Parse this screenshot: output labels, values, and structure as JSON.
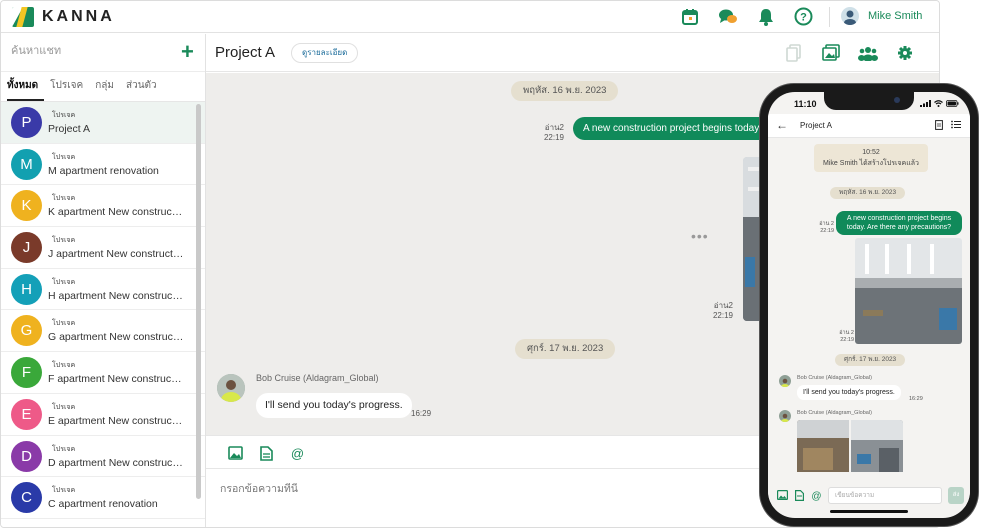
{
  "app": {
    "name": "KANNA",
    "user_name": "Mike Smith"
  },
  "colors": {
    "accent": "#108a5a",
    "date_pill": "#e5dfcf",
    "chat_bg": "#eeedeb"
  },
  "top_icons": [
    "calendar-icon",
    "chat-icon",
    "bell-icon",
    "help-icon"
  ],
  "sidebar": {
    "search_placeholder": "ค้นหาแชท",
    "add_label": "+",
    "tabs": [
      {
        "label": "ทั้งหมด",
        "active": true
      },
      {
        "label": "โปรเจค",
        "active": false
      },
      {
        "label": "กลุ่ม",
        "active": false
      },
      {
        "label": "ส่วนตัว",
        "active": false
      }
    ],
    "chats": [
      {
        "initial": "P",
        "type": "โปรเจค",
        "name": "Project A",
        "color": "#3a3aa8",
        "selected": true
      },
      {
        "initial": "M",
        "type": "โปรเจค",
        "name": "M apartment renovation",
        "color": "#12a0b0",
        "selected": false
      },
      {
        "initial": "K",
        "type": "โปรเจค",
        "name": "K apartment New construction",
        "color": "#efb21f",
        "selected": false
      },
      {
        "initial": "J",
        "type": "โปรเจค",
        "name": "J apartment New construction",
        "color": "#7a3a2a",
        "selected": false
      },
      {
        "initial": "H",
        "type": "โปรเจค",
        "name": "H apartment New construction",
        "color": "#14a0b8",
        "selected": false
      },
      {
        "initial": "G",
        "type": "โปรเจค",
        "name": "G apartment New construction",
        "color": "#efb21f",
        "selected": false
      },
      {
        "initial": "F",
        "type": "โปรเจค",
        "name": "F apartment New construction",
        "color": "#3aa83a",
        "selected": false
      },
      {
        "initial": "E",
        "type": "โปรเจค",
        "name": "E apartment New construction",
        "color": "#ee5a88",
        "selected": false
      },
      {
        "initial": "D",
        "type": "โปรเจค",
        "name": "D apartment New construction",
        "color": "#8a3aa8",
        "selected": false
      },
      {
        "initial": "C",
        "type": "โปรเจค",
        "name": "C apartment renovation",
        "color": "#2a3aa8",
        "selected": false
      }
    ]
  },
  "main": {
    "room_title": "Project A",
    "detail_label": "ดูรายละเอียด",
    "date_1": "พฤหัส. 16 พ.ย. 2023",
    "date_2": "ศุกร์. 17 พ.ย. 2023",
    "out_message": "A new construction project begins today. Are there any precautions?",
    "out_read": "อ่าน2",
    "out_time": "22:19",
    "photo_read": "อ่าน2",
    "photo_time": "22:19",
    "more_label": "•••",
    "in_sender": "Bob Cruise (Aldagram_Global)",
    "in_message": "I'll send you today's progress.",
    "in_time": "16:29",
    "composer_placeholder": "กรอกข้อความที่นี่"
  },
  "phone": {
    "time": "11:10",
    "title": "Project A",
    "back": "←",
    "sys_time": "10:52",
    "sys_text": "Mike Smith ได้สร้างโปรเจคแล้ว",
    "date_1": "พฤหัส. 16 พ.ย. 2023",
    "date_2": "ศุกร์. 17 พ.ย. 2023",
    "out_message": "A new construction project begins today. Are there any precautions?",
    "out_read": "อ่าน 2",
    "out_time": "22:19",
    "photo_read": "อ่าน 2",
    "photo_time": "22:19",
    "in_sender": "Bob Cruise (Aldagram_Global)",
    "in_message": "I'll send you today's progress.",
    "in_time": "16:29",
    "in_sender_2": "Bob Cruise (Aldagram_Global)",
    "input_placeholder": "เขียนข้อความ",
    "send_label": "ส่ง"
  }
}
